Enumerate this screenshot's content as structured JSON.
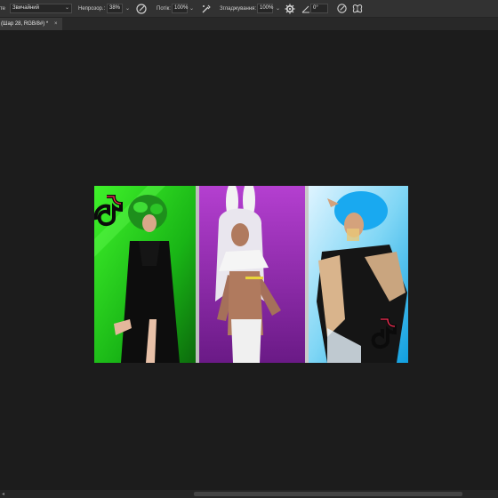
{
  "options_bar": {
    "mode_label_fragment": "те",
    "mode_value": "Звичайний",
    "opacity_label": "Непрозор.:",
    "opacity_value": "38%",
    "flow_label": "Потік:",
    "flow_value": "100%",
    "smoothing_label": "Згладжування:",
    "smoothing_value": "100%",
    "angle_value": "0°"
  },
  "document_tab": {
    "title": "(Шар 28, RGB/8#) *",
    "close": "×"
  },
  "colors": {
    "workspace": "#1c1c1c",
    "options_bar": "#323232",
    "panel_green": "#23c21a",
    "panel_purple": "#8a2aa6",
    "panel_blue": "#3ec6f0"
  }
}
